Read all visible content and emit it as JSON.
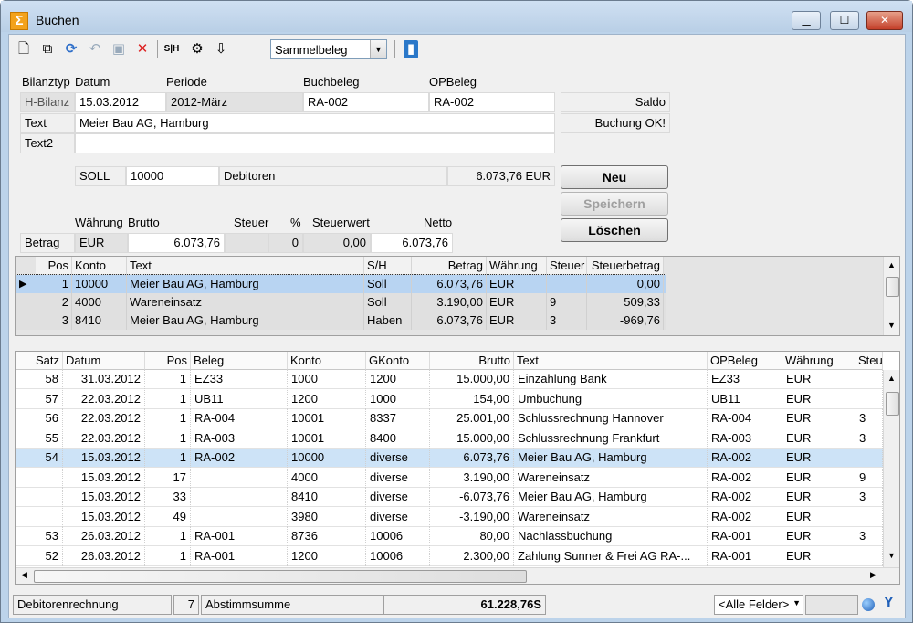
{
  "window": {
    "title": "Buchen",
    "min": "▁",
    "max": "☐",
    "close": "✕"
  },
  "toolbar": {
    "combo_value": "Sammelbeleg",
    "icons": [
      "new-icon",
      "copy-icon",
      "refresh-icon",
      "undo-icon",
      "save-icon",
      "delete-icon",
      "sh-icon",
      "settings-icon",
      "export-icon",
      "book-icon"
    ],
    "sh_label": "S|H"
  },
  "form": {
    "labels": {
      "bilanztyp": "Bilanztyp",
      "datum": "Datum",
      "periode": "Periode",
      "buchbeleg": "Buchbeleg",
      "opbeleg": "OPBeleg",
      "text": "Text",
      "text2": "Text2"
    },
    "bilanztyp": "H-Bilanz",
    "datum": "15.03.2012",
    "periode": "2012-März",
    "buchbeleg": "RA-002",
    "opbeleg": "RA-002",
    "text": "Meier Bau AG, Hamburg",
    "text2": "",
    "saldo_label": "Saldo",
    "status_msg": "Buchung OK!",
    "sh": "SOLL",
    "konto": "10000",
    "konto_name": "Debitoren",
    "konto_saldo": "6.073,76 EUR",
    "betrag_labels": {
      "waehrung": "Währung",
      "brutto": "Brutto",
      "steuer": "Steuer",
      "pct": "%",
      "steuerwert": "Steuerwert",
      "netto": "Netto",
      "betrag": "Betrag"
    },
    "betrag": {
      "waehrung": "EUR",
      "brutto": "6.073,76",
      "steuer": "",
      "pct": "0",
      "steuerwert": "0,00",
      "netto": "6.073,76"
    }
  },
  "buttons": {
    "neu": "Neu",
    "speichern": "Speichern",
    "loeschen": "Löschen"
  },
  "positions": {
    "headers": [
      "Pos",
      "Konto",
      "Text",
      "S/H",
      "Betrag",
      "Währung",
      "Steuer",
      "Steuerbetrag"
    ],
    "rows": [
      {
        "pos": "1",
        "konto": "10000",
        "text": "Meier Bau AG, Hamburg",
        "sh": "Soll",
        "betrag": "6.073,76",
        "waehrung": "EUR",
        "steuer": "",
        "steuerbetrag": "0,00"
      },
      {
        "pos": "2",
        "konto": "4000",
        "text": "Wareneinsatz",
        "sh": "Soll",
        "betrag": "3.190,00",
        "waehrung": "EUR",
        "steuer": "9",
        "steuerbetrag": "509,33"
      },
      {
        "pos": "3",
        "konto": "8410",
        "text": "Meier Bau AG, Hamburg",
        "sh": "Haben",
        "betrag": "6.073,76",
        "waehrung": "EUR",
        "steuer": "3",
        "steuerbetrag": "-969,76"
      }
    ]
  },
  "journal": {
    "headers": [
      "Satz",
      "Datum",
      "Pos",
      "Beleg",
      "Konto",
      "GKonto",
      "Brutto",
      "Text",
      "OPBeleg",
      "Währung",
      "SteuerC"
    ],
    "rows": [
      {
        "satz": "58",
        "datum": "31.03.2012",
        "pos": "1",
        "beleg": "EZ33",
        "konto": "1000",
        "gkonto": "1200",
        "brutto": "15.000,00",
        "text": "Einzahlung Bank",
        "opbeleg": "EZ33",
        "waehrung": "EUR",
        "steuer": ""
      },
      {
        "satz": "57",
        "datum": "22.03.2012",
        "pos": "1",
        "beleg": "UB11",
        "konto": "1200",
        "gkonto": "1000",
        "brutto": "154,00",
        "text": "Umbuchung",
        "opbeleg": "UB11",
        "waehrung": "EUR",
        "steuer": ""
      },
      {
        "satz": "56",
        "datum": "22.03.2012",
        "pos": "1",
        "beleg": "RA-004",
        "konto": "10001",
        "gkonto": "8337",
        "brutto": "25.001,00",
        "text": "Schlussrechnung Hannover",
        "opbeleg": "RA-004",
        "waehrung": "EUR",
        "steuer": "3"
      },
      {
        "satz": "55",
        "datum": "22.03.2012",
        "pos": "1",
        "beleg": "RA-003",
        "konto": "10001",
        "gkonto": "8400",
        "brutto": "15.000,00",
        "text": "Schlussrechnung Frankfurt",
        "opbeleg": "RA-003",
        "waehrung": "EUR",
        "steuer": "3"
      },
      {
        "satz": "54",
        "datum": "15.03.2012",
        "pos": "1",
        "beleg": "RA-002",
        "konto": "10000",
        "gkonto": "diverse",
        "brutto": "6.073,76",
        "text": "Meier Bau AG, Hamburg",
        "opbeleg": "RA-002",
        "waehrung": "EUR",
        "steuer": ""
      },
      {
        "satz": "",
        "datum": "15.03.2012",
        "pos": "17",
        "beleg": "",
        "konto": "4000",
        "gkonto": "diverse",
        "brutto": "3.190,00",
        "text": "Wareneinsatz",
        "opbeleg": "RA-002",
        "waehrung": "EUR",
        "steuer": "9"
      },
      {
        "satz": "",
        "datum": "15.03.2012",
        "pos": "33",
        "beleg": "",
        "konto": "8410",
        "gkonto": "diverse",
        "brutto": "-6.073,76",
        "text": "Meier Bau AG, Hamburg",
        "opbeleg": "RA-002",
        "waehrung": "EUR",
        "steuer": "3"
      },
      {
        "satz": "",
        "datum": "15.03.2012",
        "pos": "49",
        "beleg": "",
        "konto": "3980",
        "gkonto": "diverse",
        "brutto": "-3.190,00",
        "text": "Wareneinsatz",
        "opbeleg": "RA-002",
        "waehrung": "EUR",
        "steuer": ""
      },
      {
        "satz": "53",
        "datum": "26.03.2012",
        "pos": "1",
        "beleg": "RA-001",
        "konto": "8736",
        "gkonto": "10006",
        "brutto": "80,00",
        "text": "Nachlassbuchung",
        "opbeleg": "RA-001",
        "waehrung": "EUR",
        "steuer": "3"
      },
      {
        "satz": "52",
        "datum": "26.03.2012",
        "pos": "1",
        "beleg": "RA-001",
        "konto": "1200",
        "gkonto": "10006",
        "brutto": "2.300,00",
        "text": "Zahlung Sunner & Frei AG RA-...",
        "opbeleg": "RA-001",
        "waehrung": "EUR",
        "steuer": ""
      }
    ]
  },
  "statusbar": {
    "name": "Debitorenrechnung",
    "count": "7",
    "label": "Abstimmsumme",
    "sum": "61.228,76S",
    "filter": "<Alle Felder>"
  },
  "colors": {
    "selected_row": "#cde3f7",
    "selected_pos": "#b8d4f2",
    "accent": "#3a6ea5"
  }
}
